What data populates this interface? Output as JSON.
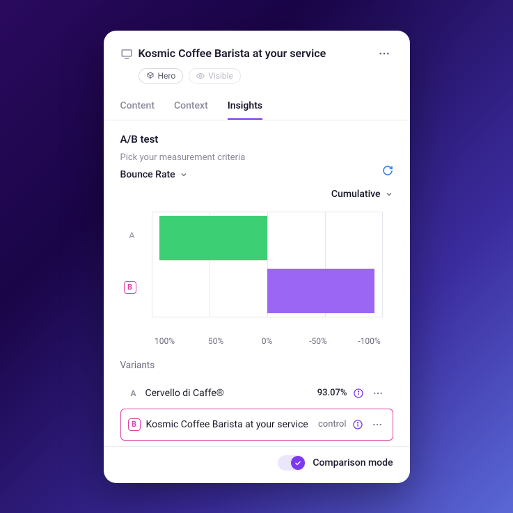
{
  "header": {
    "title": "Kosmic Coffee Barista at your service",
    "badge_hero": "Hero",
    "badge_visible": "Visible"
  },
  "tabs": {
    "content": "Content",
    "context": "Context",
    "insights": "Insights"
  },
  "ab_test": {
    "title": "A/B test",
    "criteria_label": "Pick your measurement criteria",
    "metric": "Bounce Rate",
    "cumulative": "Cumulative"
  },
  "chart_data": {
    "type": "bar",
    "orientation": "horizontal",
    "x_ticks": [
      "100%",
      "50%",
      "0%",
      "-50%",
      "-100%"
    ],
    "series": [
      {
        "id": "A",
        "label": "A",
        "value": 93,
        "color": "#3ccf74"
      },
      {
        "id": "B",
        "label": "B",
        "value": -93,
        "color": "#9b66f3"
      }
    ],
    "xlim": [
      -100,
      100
    ]
  },
  "variants": {
    "title": "Variants",
    "rows": [
      {
        "marker": "A",
        "name": "Cervello di Caffe®",
        "pct": "93.07%",
        "control": "",
        "selected": false
      },
      {
        "marker": "B",
        "name": "Kosmic Coffee Barista at your service",
        "pct": "",
        "control": "control",
        "selected": true
      }
    ]
  },
  "footer": {
    "comparison": "Comparison mode"
  }
}
